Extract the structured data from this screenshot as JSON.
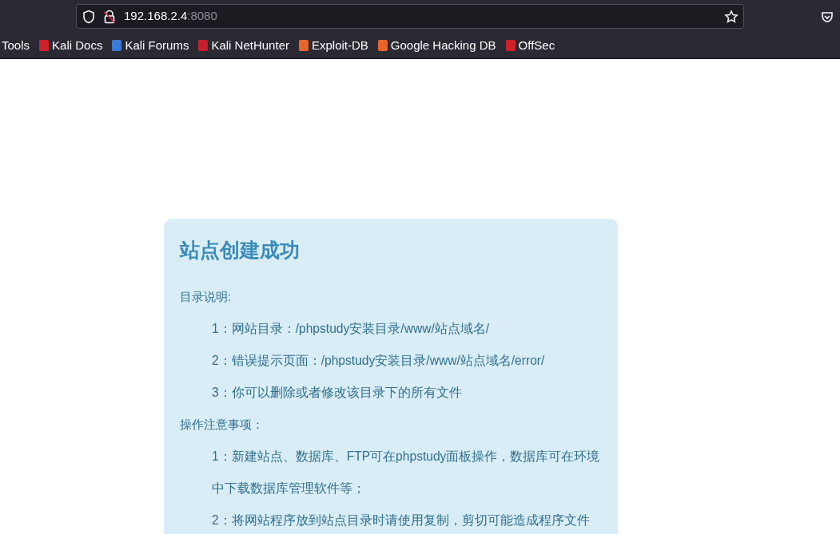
{
  "address_bar": {
    "host": "192.168.2.4",
    "port": ":8080"
  },
  "bookmarks": [
    {
      "label": "Tools"
    },
    {
      "label": "Kali Docs",
      "color": "#d0202a"
    },
    {
      "label": "Kali Forums",
      "color": "#3a7bd5"
    },
    {
      "label": "Kali NetHunter",
      "color": "#c8202a"
    },
    {
      "label": "Exploit-DB",
      "color": "#e8652a"
    },
    {
      "label": "Google Hacking DB",
      "color": "#e8652a"
    },
    {
      "label": "OffSec",
      "color": "#d0202a"
    }
  ],
  "card": {
    "title": "站点创建成功",
    "sections": [
      {
        "heading": "目录说明:",
        "items": [
          "1：网站目录：/phpstudy安装目录/www/站点域名/",
          "2：错误提示页面：/phpstudy安装目录/www/站点域名/error/",
          "3：你可以删除或者修改该目录下的所有文件"
        ]
      },
      {
        "heading": "操作注意事项：",
        "items": [
          "1：新建站点、数据库、FTP可在phpstudy面板操作，数据库可在环境中下载数据库管理软件等；",
          "2：将网站程序放到站点目录时请使用复制，剪切可能造成程序文件"
        ]
      }
    ]
  }
}
